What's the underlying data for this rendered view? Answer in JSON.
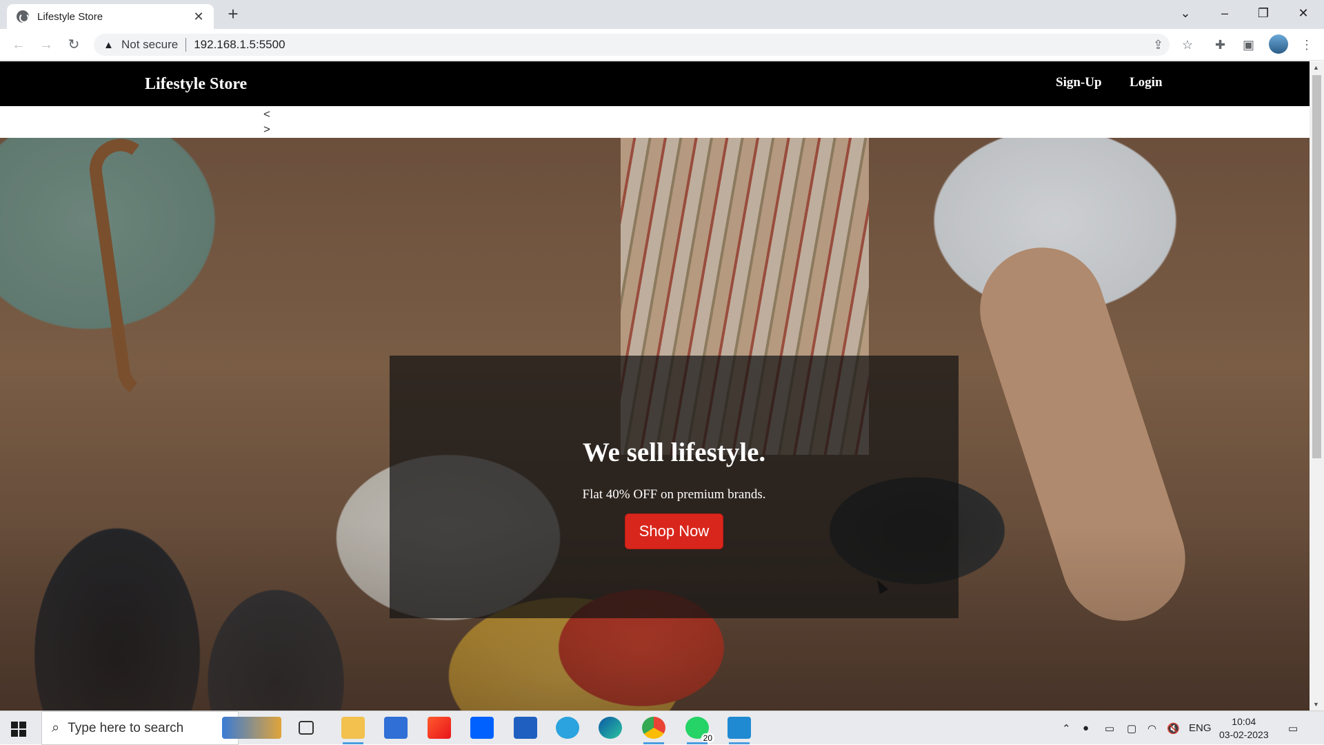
{
  "browser": {
    "tab_title": "Lifestyle Store",
    "tab_close": "✕",
    "new_tab": "+",
    "security_label": "Not secure",
    "url": "192.168.1.5:5500",
    "window_controls": [
      "⌄",
      "–",
      "❐",
      "✕"
    ]
  },
  "navbar": {
    "brand": "Lifestyle Store",
    "signup": "Sign-Up",
    "login": "Login"
  },
  "carousel": {
    "prev": "<",
    "next": ">"
  },
  "banner": {
    "heading": "We sell lifestyle.",
    "subtext": "Flat 40% OFF on premium brands.",
    "button": "Shop Now"
  },
  "taskbar": {
    "search_placeholder": "Type here to search",
    "whatsapp_badge": "20",
    "lang": "ENG",
    "time": "10:04",
    "date": "03-02-2023"
  },
  "colors": {
    "navbar_bg": "#000000",
    "button_red": "#d9261c"
  }
}
